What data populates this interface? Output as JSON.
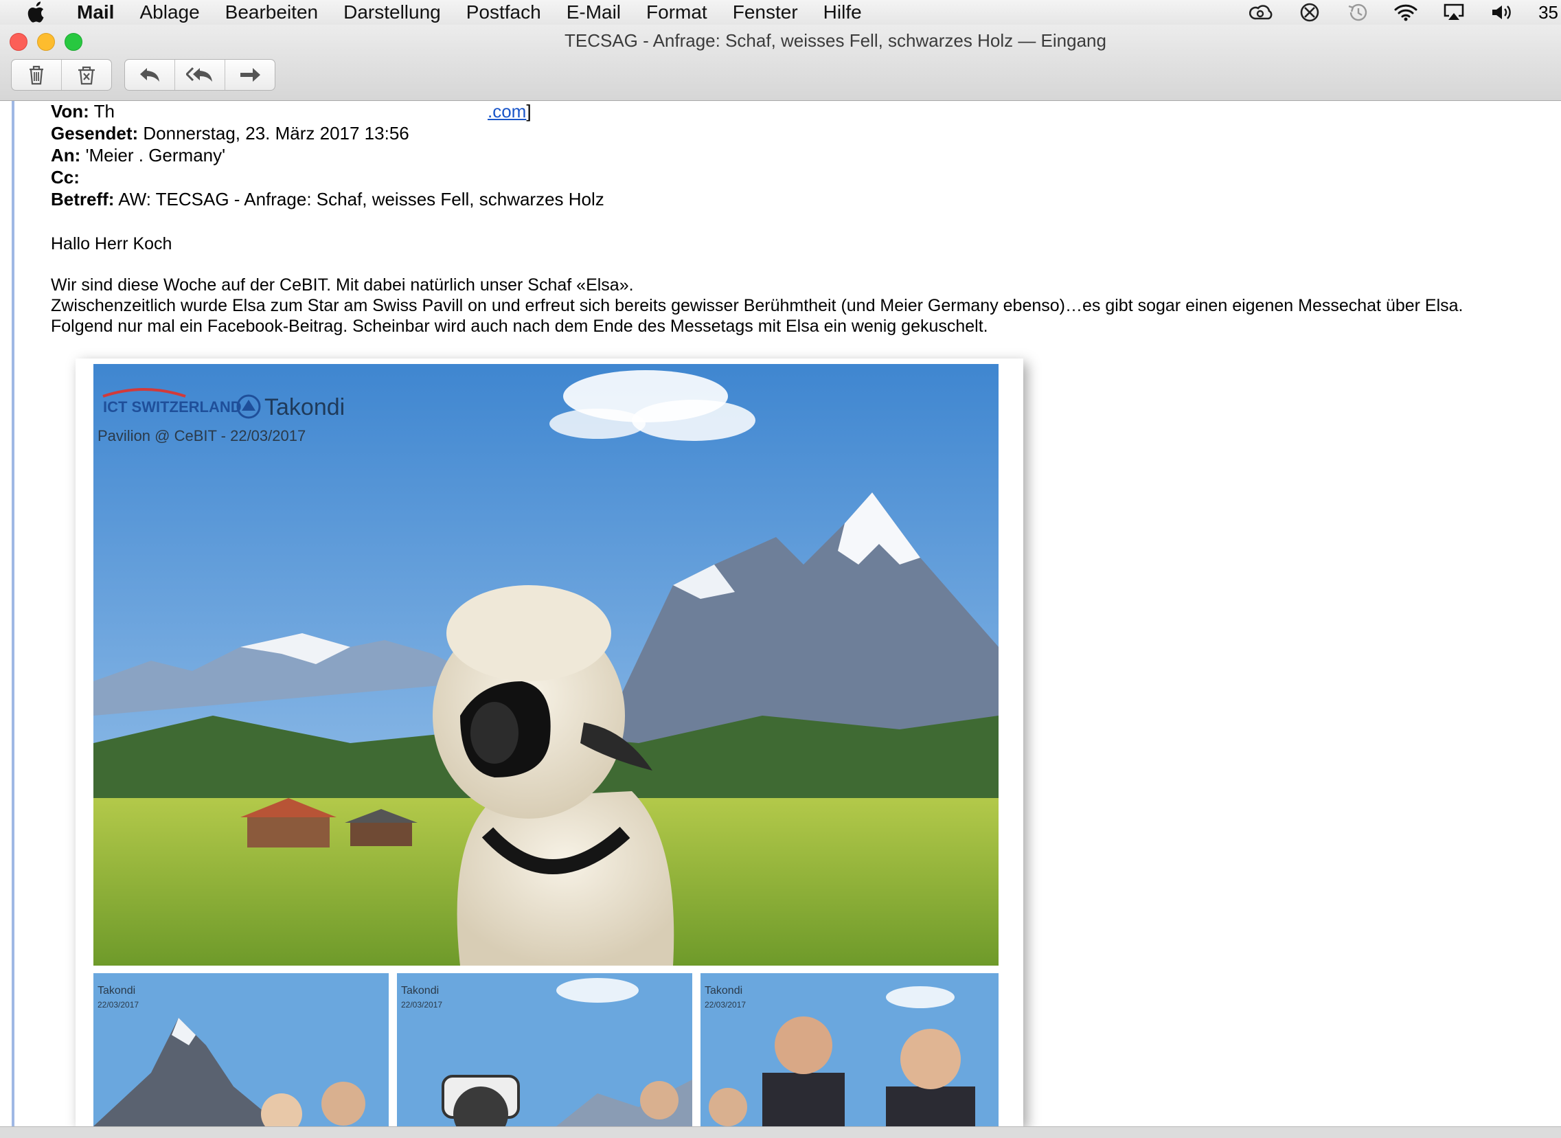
{
  "menubar": {
    "app_name": "Mail",
    "items": [
      "Ablage",
      "Bearbeiten",
      "Darstellung",
      "Postfach",
      "E-Mail",
      "Format",
      "Fenster",
      "Hilfe"
    ],
    "clock": "35"
  },
  "window": {
    "title": "TECSAG - Anfrage: Schaf, weisses Fell, schwarzes Holz — Eingang"
  },
  "header": {
    "from_label": "Von:",
    "from_value": "Th",
    "from_link": ".com",
    "from_bracket": "]",
    "sent_label": "Gesendet:",
    "sent_value": "Donnerstag, 23. März 2017 13:56",
    "to_label": "An:",
    "to_value": "'Meier . Germany'",
    "cc_label": "Cc:",
    "cc_value": "",
    "subject_label": "Betreff:",
    "subject_value": "AW: TECSAG - Anfrage: Schaf, weisses Fell, schwarzes Holz"
  },
  "body": {
    "greeting": "Hallo Herr Koch",
    "line1": "Wir sind diese Woche auf der CeBIT. Mit dabei natürlich unser Schaf «Elsa».",
    "line2": "Zwischenzeitlich wurde Elsa zum Star am Swiss Pavill on und erfreut sich bereits gewisser Berühmtheit (und Meier Germany ebenso)…es gibt sogar einen eigenen Messechat über Elsa.",
    "line3": "Folgend nur mal ein Facebook-Beitrag. Scheinbar wird auch nach dem Ende des Messetags mit Elsa ein wenig gekuschelt."
  },
  "photo": {
    "brand_ict": "ICT SWITZERLAND",
    "brand_takondi": "Takondi",
    "caption": "Pavilion @ CeBIT - 22/03/2017",
    "thumb_brand": "Takondi",
    "thumb_date": "22/03/2017"
  },
  "colors": {
    "sky": "#4f93d6",
    "meadow": "#8fb23a",
    "quote_bar": "#9fb8e4",
    "link": "#1a56c9"
  }
}
